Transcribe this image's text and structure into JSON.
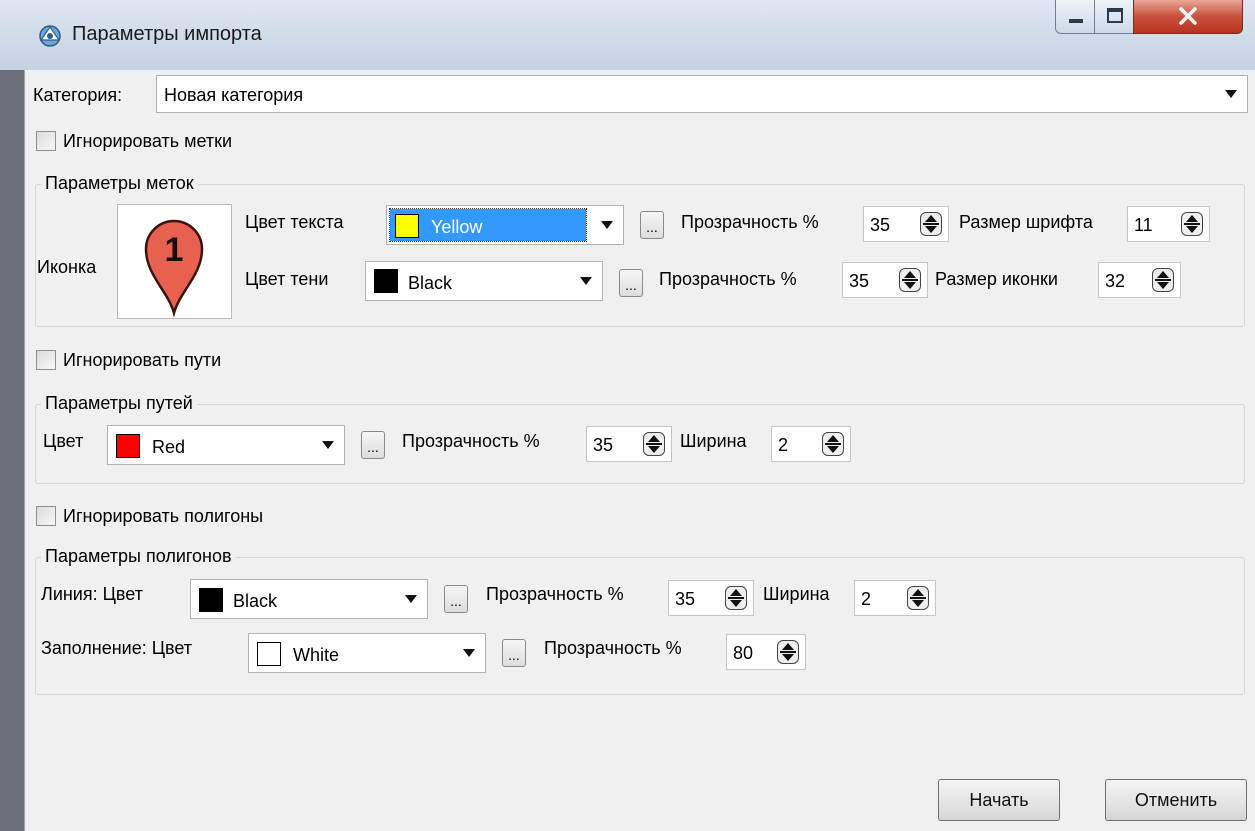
{
  "window": {
    "title": "Параметры импорта",
    "icons": {
      "app": "globe-tool-icon",
      "minimize": "minimize-icon",
      "maximize": "maximize-icon",
      "close": "close-icon"
    }
  },
  "category": {
    "label": "Категория:",
    "value": "Новая категория"
  },
  "placemarks": {
    "ignore_label": "Игнорировать метки",
    "group_title": "Параметры меток",
    "icon_label": "Иконка",
    "icon_number": "1",
    "text_color_label": "Цвет текста",
    "text_color_value": "Yellow",
    "text_color_hex": "#ffff00",
    "text_opacity_label": "Прозрачность %",
    "text_opacity_value": "35",
    "font_size_label": "Размер шрифта",
    "font_size_value": "11",
    "shadow_color_label": "Цвет тени",
    "shadow_color_value": "Black",
    "shadow_color_hex": "#000000",
    "shadow_opacity_label": "Прозрачность %",
    "shadow_opacity_value": "35",
    "icon_size_label": "Размер иконки",
    "icon_size_value": "32"
  },
  "paths": {
    "ignore_label": "Игнорировать пути",
    "group_title": "Параметры путей",
    "color_label": "Цвет",
    "color_value": "Red",
    "color_hex": "#ff0000",
    "opacity_label": "Прозрачность %",
    "opacity_value": "35",
    "width_label": "Ширина",
    "width_value": "2"
  },
  "polygons": {
    "ignore_label": "Игнорировать полигоны",
    "group_title": "Параметры полигонов",
    "line_label": "Линия: Цвет",
    "line_color_value": "Black",
    "line_color_hex": "#000000",
    "line_opacity_label": "Прозрачность %",
    "line_opacity_value": "35",
    "line_width_label": "Ширина",
    "line_width_value": "2",
    "fill_label": "Заполнение: Цвет",
    "fill_color_value": "White",
    "fill_color_hex": "#ffffff",
    "fill_opacity_label": "Прозрачность %",
    "fill_opacity_value": "80"
  },
  "buttons": {
    "start": "Начать",
    "cancel": "Отменить",
    "ellipsis": "..."
  },
  "colors": {
    "selection": "#3399ff",
    "close_button": "#c8523e",
    "pin": "#e8604f"
  }
}
